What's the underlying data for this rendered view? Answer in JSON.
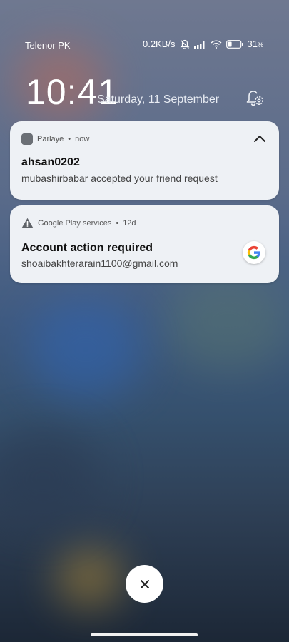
{
  "status": {
    "carrier": "Telenor PK",
    "speed": "0.2KB/s",
    "battery": "31",
    "battery_percent": 31
  },
  "lockscreen": {
    "time": "10:41",
    "date": "Saturday, 11 September"
  },
  "notifications": [
    {
      "app": "Parlaye",
      "when": "now",
      "title": "ahsan0202",
      "text": "mubashirbabar accepted your friend request"
    },
    {
      "app": "Google Play services",
      "when": "12d",
      "title": "Account action required",
      "text": "shoaibakhterarain1100@gmail.com"
    }
  ],
  "icons": {
    "mute": "bell-off-icon",
    "signal": "signal-icon",
    "wifi": "wifi-icon",
    "battery": "battery-icon",
    "settings": "notification-settings-icon",
    "collapse": "chevron-up-icon",
    "warning": "warning-icon",
    "google": "google-logo-icon",
    "close": "close-icon"
  }
}
